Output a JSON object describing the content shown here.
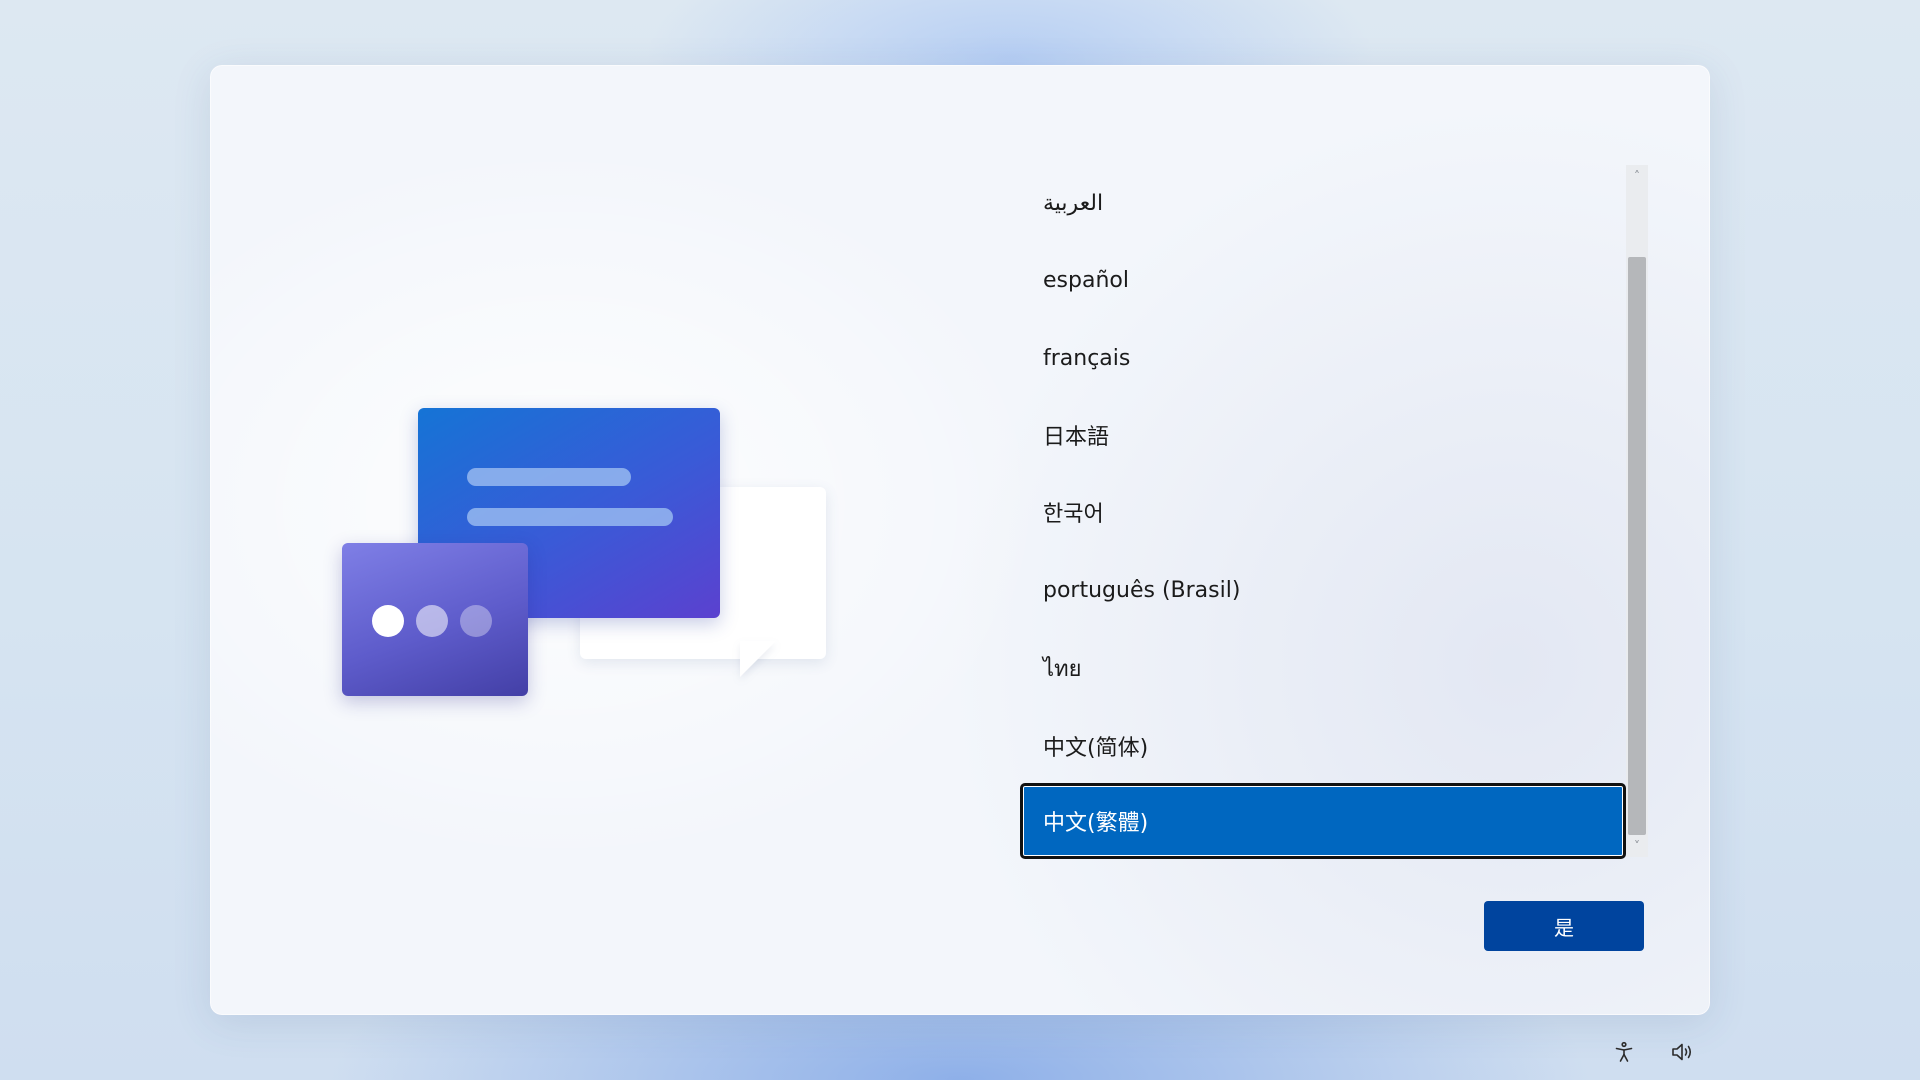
{
  "languages": [
    {
      "label": "العربية",
      "selected": false
    },
    {
      "label": "español",
      "selected": false
    },
    {
      "label": "français",
      "selected": false
    },
    {
      "label": "日本語",
      "selected": false
    },
    {
      "label": "한국어",
      "selected": false
    },
    {
      "label": "português (Brasil)",
      "selected": false
    },
    {
      "label": "ไทย",
      "selected": false
    },
    {
      "label": "中文(简体)",
      "selected": false
    },
    {
      "label": "中文(繁體)",
      "selected": true
    }
  ],
  "scrollbar": {
    "up_arrow": "˄",
    "down_arrow": "˅"
  },
  "primary_button": {
    "label": "是"
  },
  "tray": {
    "accessibility_icon": "accessibility-icon",
    "volume_icon": "volume-icon"
  },
  "colors": {
    "accent": "#0067c0",
    "button": "#00449e"
  }
}
